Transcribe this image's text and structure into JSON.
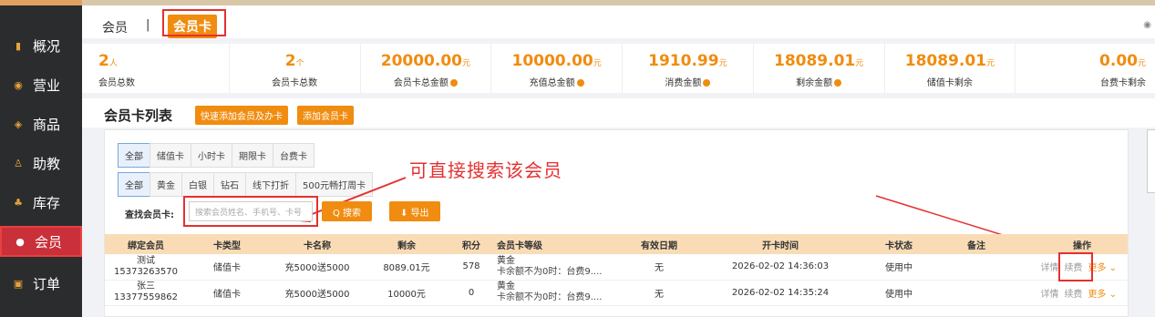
{
  "sidebar": {
    "items": [
      {
        "label": "概况",
        "icon": "bar-chart-icon"
      },
      {
        "label": "营业",
        "icon": "circle-dot-icon"
      },
      {
        "label": "商品",
        "icon": "box-icon"
      },
      {
        "label": "助教",
        "icon": "person-icon"
      },
      {
        "label": "库存",
        "icon": "warehouse-icon"
      },
      {
        "label": "会员",
        "icon": "member-icon"
      },
      {
        "label": "订单",
        "icon": "order-icon"
      }
    ],
    "active": "会员"
  },
  "topbar": {
    "breadcrumb": "会员",
    "separator": "|",
    "active_tab": "会员卡"
  },
  "stats": [
    {
      "value": "2",
      "unit": "人",
      "label": "会员总数"
    },
    {
      "value": "2",
      "unit": "个",
      "label": "会员卡总数"
    },
    {
      "value": "20000.00",
      "unit": "元",
      "label": "会员卡总金额"
    },
    {
      "value": "10000.00",
      "unit": "元",
      "label": "充值总金额"
    },
    {
      "value": "1910.99",
      "unit": "元",
      "label": "消费金额"
    },
    {
      "value": "18089.01",
      "unit": "元",
      "label": "剩余金额"
    },
    {
      "value": "18089.01",
      "unit": "元",
      "label": "储值卡剩余"
    },
    {
      "value": "0.00",
      "unit": "元",
      "label": "台费卡剩余"
    }
  ],
  "list": {
    "title": "会员卡列表",
    "quick_add": "快速添加会员及办卡",
    "add_card": "添加会员卡"
  },
  "filters": {
    "type": [
      "全部",
      "储值卡",
      "小时卡",
      "期限卡",
      "台费卡"
    ],
    "grade": [
      "全部",
      "黄金",
      "白银",
      "钻石",
      "线下打折",
      "500元畅打周卡"
    ]
  },
  "search": {
    "label": "查找会员卡:",
    "placeholder": "搜索会员姓名、手机号、卡号",
    "search_btn": "Q 搜索",
    "export_btn": "⬇ 导出"
  },
  "annotation": "可直接搜索该会员",
  "table": {
    "headers": [
      "绑定会员",
      "卡类型",
      "卡名称",
      "剩余",
      "积分",
      "会员卡等级",
      "有效日期",
      "开卡时间",
      "卡状态",
      "备注",
      "操作"
    ],
    "rows": [
      {
        "name": "测试",
        "phone": "15373263570",
        "type": "储值卡",
        "card": "充5000送5000",
        "remain": "8089.01元",
        "points": "578",
        "grade": "黄金",
        "grade_sub": "卡余额不为0时：台费9....",
        "valid": "无",
        "opened": "2026-02-02 14:36:03",
        "status": "使用中",
        "note": "",
        "op1": "详情",
        "op2": "续费",
        "op3": "更多 ⌄"
      },
      {
        "name": "张三",
        "phone": "13377559862",
        "type": "储值卡",
        "card": "充5000送5000",
        "remain": "10000元",
        "points": "0",
        "grade": "黄金",
        "grade_sub": "卡余额不为0时：台费9....",
        "valid": "无",
        "opened": "2026-02-02 14:35:24",
        "status": "使用中",
        "note": "",
        "op1": "详情",
        "op2": "续费",
        "op3": "更多 ⌄"
      }
    ]
  },
  "colors": {
    "accent": "#f08c10",
    "sidebar": "#2b2c2e",
    "highlight": "#e53030",
    "header_row": "#f9dcb6"
  }
}
